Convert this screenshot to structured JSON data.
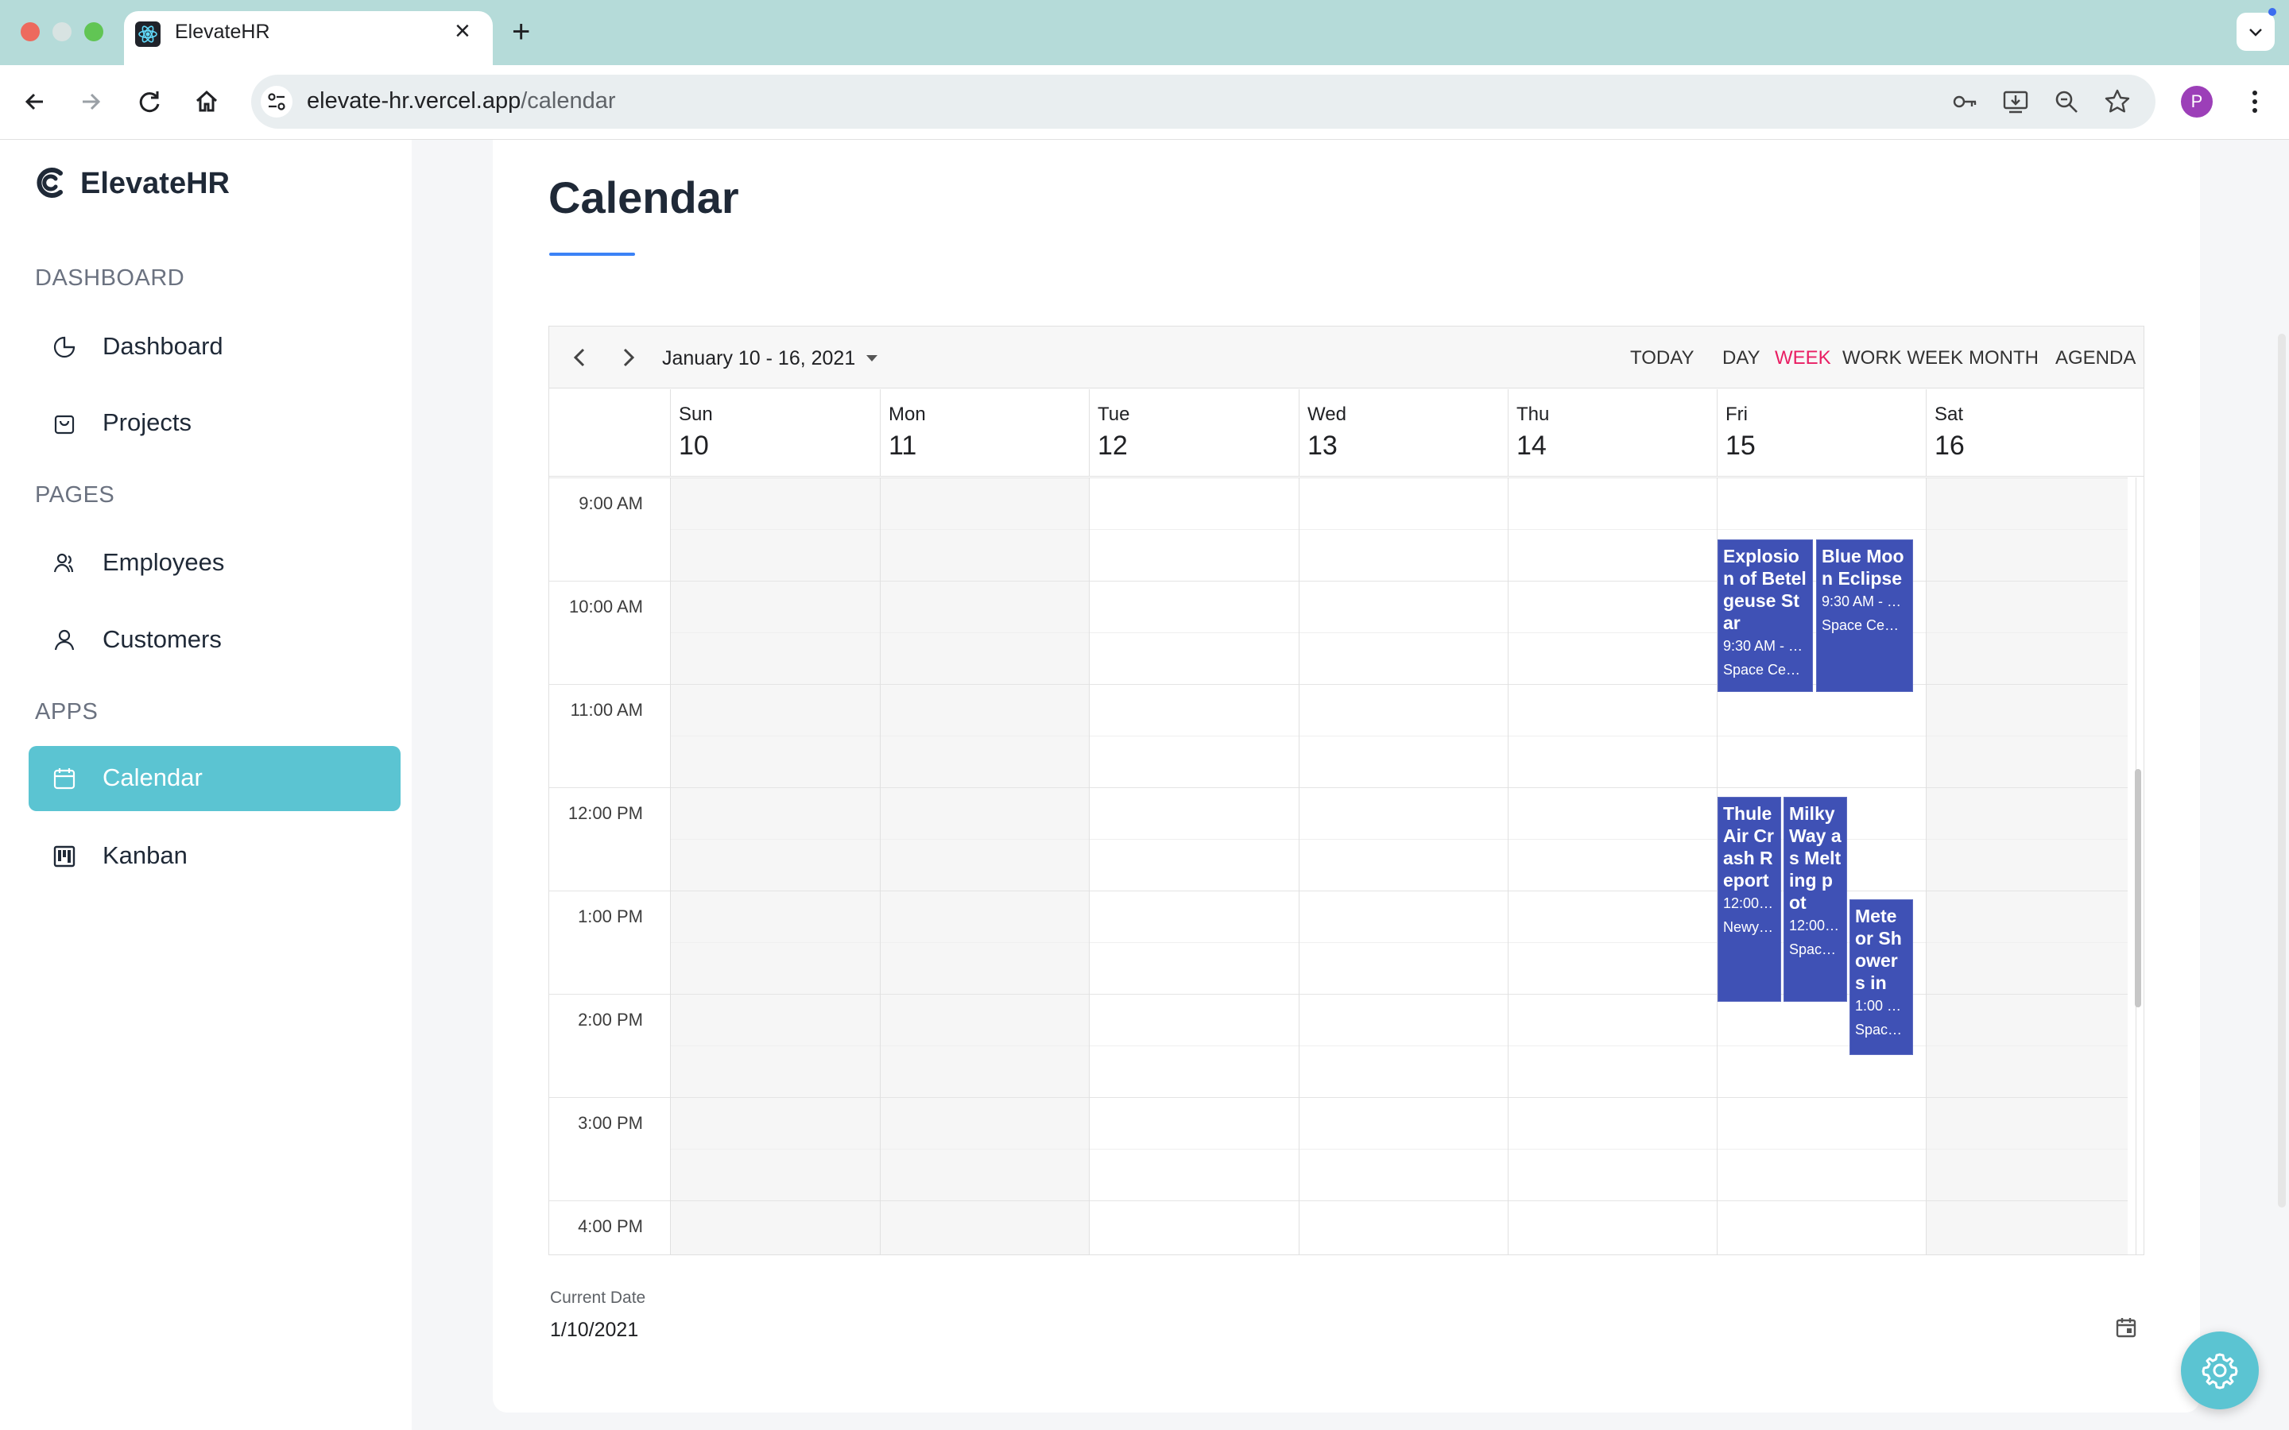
{
  "browser": {
    "tab_title": "ElevateHR",
    "url_host": "elevate-hr.vercel.app",
    "url_path": "/calendar",
    "profile_initial": "P"
  },
  "sidebar": {
    "brand": "ElevateHR",
    "sections": [
      {
        "label": "DASHBOARD",
        "items": [
          {
            "label": "Dashboard",
            "icon": "pie-chart-icon"
          },
          {
            "label": "Projects",
            "icon": "shopping-bag-icon"
          }
        ]
      },
      {
        "label": "PAGES",
        "items": [
          {
            "label": "Employees",
            "icon": "users-icon"
          },
          {
            "label": "Customers",
            "icon": "user-icon"
          }
        ]
      },
      {
        "label": "APPS",
        "items": [
          {
            "label": "Calendar",
            "icon": "calendar-icon",
            "active": true
          },
          {
            "label": "Kanban",
            "icon": "kanban-icon"
          }
        ]
      }
    ]
  },
  "page": {
    "title": "Calendar",
    "accent": "#3b82f6"
  },
  "scheduler": {
    "date_range": "January 10 - 16, 2021",
    "today_label": "TODAY",
    "views": [
      "DAY",
      "WEEK",
      "WORK WEEK",
      "MONTH",
      "AGENDA"
    ],
    "active_view": "WEEK",
    "days": [
      {
        "name": "Sun",
        "date": "10"
      },
      {
        "name": "Mon",
        "date": "11"
      },
      {
        "name": "Tue",
        "date": "12"
      },
      {
        "name": "Wed",
        "date": "13"
      },
      {
        "name": "Thu",
        "date": "14"
      },
      {
        "name": "Fri",
        "date": "15"
      },
      {
        "name": "Sat",
        "date": "16"
      }
    ],
    "times": [
      "9:00 AM",
      "10:00 AM",
      "11:00 AM",
      "12:00 PM",
      "1:00 PM",
      "2:00 PM",
      "3:00 PM",
      "4:00 PM"
    ],
    "appointments": [
      {
        "title": "Explosion of Betelgeuse Star",
        "time": "9:30 AM - …",
        "location": "Space Ce…"
      },
      {
        "title": "Blue Moon Eclipse",
        "time": "9:30 AM - …",
        "location": "Space Ce…"
      },
      {
        "title": "Thule Air Crash Report",
        "time": "12:00…",
        "location": "Newy…"
      },
      {
        "title": "Milky Way as Melting pot",
        "time": "12:00…",
        "location": "Spac…"
      },
      {
        "title": "Meteor Showers in",
        "time": "1:00 …",
        "location": "Spac…"
      }
    ],
    "appointment_color": "#3f51b5",
    "active_view_color": "#e91e63"
  },
  "current_date": {
    "label": "Current Date",
    "value": "1/10/2021"
  },
  "settings_fab": {
    "icon": "gear-icon",
    "color": "#5bc4d2"
  }
}
